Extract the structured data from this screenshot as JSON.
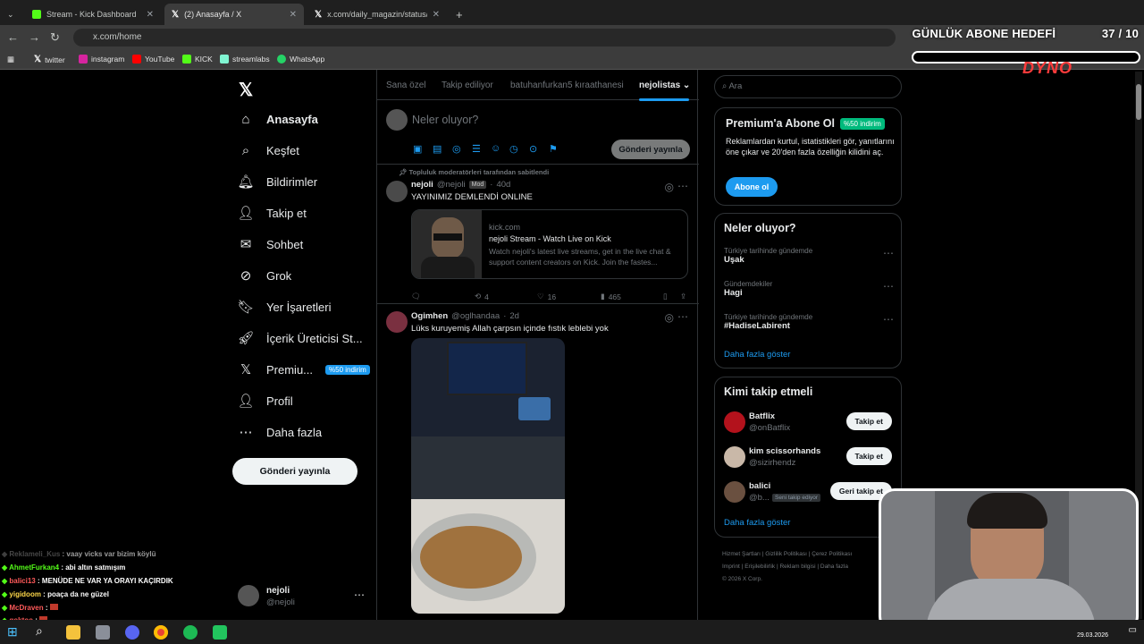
{
  "browser": {
    "tabs": [
      {
        "title": "Stream - Kick Dashboard"
      },
      {
        "title": "(2) Anasayfa / X"
      },
      {
        "title": "x.com/daily_magazin/status/20"
      }
    ],
    "url": "x.com/home",
    "bookmarks": [
      "twitter",
      "instagram",
      "YouTube",
      "KICK",
      "streamlabs",
      "WhatsApp"
    ]
  },
  "overlay": {
    "goal_title": "GÜNLÜK ABONE HEDEFİ",
    "goal_count": "37 / 10",
    "logo": "DYNO"
  },
  "sidebar": {
    "items": [
      {
        "label": "Anasayfa",
        "icon": "home-icon"
      },
      {
        "label": "Keşfet",
        "icon": "search-icon"
      },
      {
        "label": "Bildirimler",
        "icon": "bell-icon"
      },
      {
        "label": "Takip et",
        "icon": "follow-icon"
      },
      {
        "label": "Sohbet",
        "icon": "mail-icon"
      },
      {
        "label": "Grok",
        "icon": "grok-icon"
      },
      {
        "label": "Yer İşaretleri",
        "icon": "bookmark-icon"
      },
      {
        "label": "İçerik Üreticisi St...",
        "icon": "rocket-icon"
      },
      {
        "label": "Premiu...",
        "icon": "x-icon"
      },
      {
        "label": "Profil",
        "icon": "profile-icon"
      },
      {
        "label": "Daha fazla",
        "icon": "more-icon"
      }
    ],
    "premium_badge": "%50 indirim",
    "post_button": "Gönderi yayınla",
    "account": {
      "name": "nejoli",
      "handle": "@nejoli"
    }
  },
  "feed": {
    "tabs": [
      "Sana özel",
      "Takip ediliyor",
      "batuhanfurkan5 kıraathanesi",
      "nejolistas"
    ],
    "composer_placeholder": "Neler oluyor?",
    "composer_button": "Gönderi yayınla",
    "pinned_note": "Topluluk moderatörleri tarafından sabitlendi",
    "tweets": [
      {
        "name": "nejoli",
        "handle": "@nejoli",
        "badge": "Mod",
        "time": "40d",
        "text": "YAYINIMIZ DEMLENDİ ONLINE",
        "card": {
          "domain": "kick.com",
          "title": "nejoli Stream - Watch Live on Kick",
          "desc": "Watch nejoli's latest live streams, get in the live chat & support content creators on Kick. Join the fastes..."
        },
        "retweets": "4",
        "likes": "16",
        "views": "465"
      },
      {
        "name": "Ogimhen",
        "handle": "@oglhandaa",
        "time": "2d",
        "text": "Lüks kuruyemiş Allah çarpsın içinde fıstık leblebi yok"
      }
    ]
  },
  "right": {
    "search_placeholder": "Ara",
    "premium": {
      "title": "Premium'a Abone Ol",
      "badge": "%50 indirim",
      "text": "Reklamlardan kurtul, istatistikleri gör, yanıtlarını öne çıkar ve 20'den fazla özelliğin kilidini aç.",
      "button": "Abone ol"
    },
    "trends": {
      "title": "Neler oluyor?",
      "items": [
        {
          "context": "Türkiye tarihinde gündemde",
          "name": "Uşak"
        },
        {
          "context": "Gündemdekiler",
          "name": "Hagi"
        },
        {
          "context": "Türkiye tarihinde gündemde",
          "name": "#HadiseLabirent"
        }
      ],
      "more": "Daha fazla göster"
    },
    "who": {
      "title": "Kimi takip etmeli",
      "items": [
        {
          "name": "Batflix",
          "handle": "@onBatflix",
          "button": "Takip et"
        },
        {
          "name": "kim scissorhands",
          "handle": "@sizirhendz",
          "button": "Takip et"
        },
        {
          "name": "balici",
          "handle": "@b...",
          "note": "Seni takip ediyor",
          "button": "Geri takip et"
        }
      ],
      "more": "Daha fazla göster"
    },
    "footer": [
      "Hizmet Şartları",
      "Gizlilik Politikası",
      "Çerez Politikası",
      "Imprint",
      "Erişilebilirlik",
      "Reklam bilgisi",
      "Daha fazla",
      "© 2026 X Corp."
    ]
  },
  "chat": [
    {
      "user": "Reklameli_Kus",
      "msg": "vaay vicks var bizim köylü",
      "color": "#6a6a6a"
    },
    {
      "user": "AhmetFurkan4",
      "msg": "abi altın satmışım",
      "color": "#53fc18"
    },
    {
      "user": "balici13",
      "msg": "MENÜDE NE VAR YA ORAYI KAÇIRDIK",
      "color": "#ff5a5a"
    },
    {
      "user": "yigidoom",
      "msg": "poaça da ne güzel",
      "color": "#ffd84a"
    },
    {
      "user": "McDraven",
      "msg": "",
      "color": "#ff5a5a"
    },
    {
      "user": "goktoo",
      "msg": "",
      "color": "#ff5a5a"
    }
  ],
  "taskbar": {
    "date": "29.03.2026"
  }
}
